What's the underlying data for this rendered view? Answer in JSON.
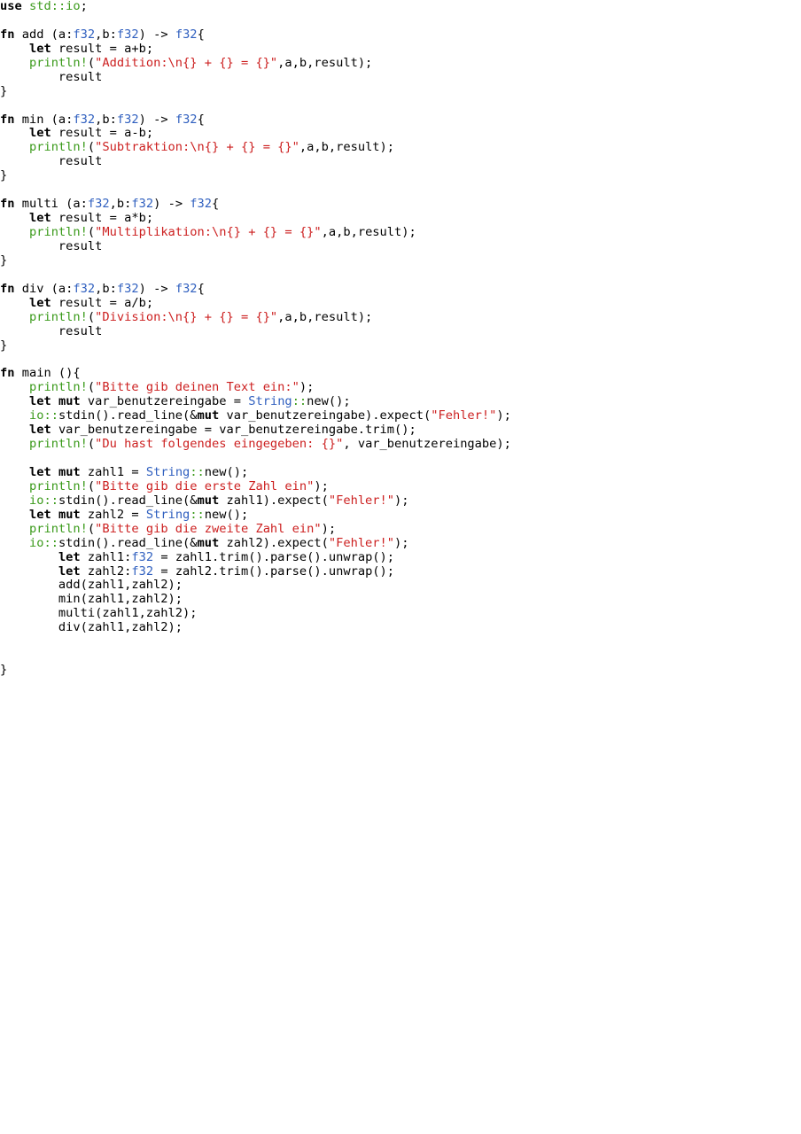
{
  "colors": {
    "keyword": "#000000",
    "type": "#2f5fbf",
    "macro": "#3a9a1a",
    "string": "#cc1f1f",
    "text": "#000000",
    "background": "#ffffff"
  },
  "code_lines": [
    [
      {
        "t": "kw",
        "v": "use"
      },
      {
        "t": "plain",
        "v": " "
      },
      {
        "t": "mac",
        "v": "std::io"
      },
      {
        "t": "plain",
        "v": ";"
      }
    ],
    [],
    [
      {
        "t": "kw",
        "v": "fn"
      },
      {
        "t": "plain",
        "v": " add (a:"
      },
      {
        "t": "ty",
        "v": "f32"
      },
      {
        "t": "plain",
        "v": ",b:"
      },
      {
        "t": "ty",
        "v": "f32"
      },
      {
        "t": "plain",
        "v": ") -> "
      },
      {
        "t": "ty",
        "v": "f32"
      },
      {
        "t": "plain",
        "v": "{"
      }
    ],
    [
      {
        "t": "plain",
        "v": "    "
      },
      {
        "t": "kw",
        "v": "let"
      },
      {
        "t": "plain",
        "v": " result = a+b;"
      }
    ],
    [
      {
        "t": "plain",
        "v": "    "
      },
      {
        "t": "mac",
        "v": "println!"
      },
      {
        "t": "plain",
        "v": "("
      },
      {
        "t": "str",
        "v": "\"Addition:\\n{} + {} = {}\""
      },
      {
        "t": "plain",
        "v": ",a,b,result);"
      }
    ],
    [
      {
        "t": "plain",
        "v": "        result"
      }
    ],
    [
      {
        "t": "plain",
        "v": "}"
      }
    ],
    [],
    [
      {
        "t": "kw",
        "v": "fn"
      },
      {
        "t": "plain",
        "v": " min (a:"
      },
      {
        "t": "ty",
        "v": "f32"
      },
      {
        "t": "plain",
        "v": ",b:"
      },
      {
        "t": "ty",
        "v": "f32"
      },
      {
        "t": "plain",
        "v": ") -> "
      },
      {
        "t": "ty",
        "v": "f32"
      },
      {
        "t": "plain",
        "v": "{"
      }
    ],
    [
      {
        "t": "plain",
        "v": "    "
      },
      {
        "t": "kw",
        "v": "let"
      },
      {
        "t": "plain",
        "v": " result = a-b;"
      }
    ],
    [
      {
        "t": "plain",
        "v": "    "
      },
      {
        "t": "mac",
        "v": "println!"
      },
      {
        "t": "plain",
        "v": "("
      },
      {
        "t": "str",
        "v": "\"Subtraktion:\\n{} + {} = {}\""
      },
      {
        "t": "plain",
        "v": ",a,b,result);"
      }
    ],
    [
      {
        "t": "plain",
        "v": "        result"
      }
    ],
    [
      {
        "t": "plain",
        "v": "}"
      }
    ],
    [],
    [
      {
        "t": "kw",
        "v": "fn"
      },
      {
        "t": "plain",
        "v": " multi (a:"
      },
      {
        "t": "ty",
        "v": "f32"
      },
      {
        "t": "plain",
        "v": ",b:"
      },
      {
        "t": "ty",
        "v": "f32"
      },
      {
        "t": "plain",
        "v": ") -> "
      },
      {
        "t": "ty",
        "v": "f32"
      },
      {
        "t": "plain",
        "v": "{"
      }
    ],
    [
      {
        "t": "plain",
        "v": "    "
      },
      {
        "t": "kw",
        "v": "let"
      },
      {
        "t": "plain",
        "v": " result = a*b;"
      }
    ],
    [
      {
        "t": "plain",
        "v": "    "
      },
      {
        "t": "mac",
        "v": "println!"
      },
      {
        "t": "plain",
        "v": "("
      },
      {
        "t": "str",
        "v": "\"Multiplikation:\\n{} + {} = {}\""
      },
      {
        "t": "plain",
        "v": ",a,b,result);"
      }
    ],
    [
      {
        "t": "plain",
        "v": "        result"
      }
    ],
    [
      {
        "t": "plain",
        "v": "}"
      }
    ],
    [],
    [
      {
        "t": "kw",
        "v": "fn"
      },
      {
        "t": "plain",
        "v": " div (a:"
      },
      {
        "t": "ty",
        "v": "f32"
      },
      {
        "t": "plain",
        "v": ",b:"
      },
      {
        "t": "ty",
        "v": "f32"
      },
      {
        "t": "plain",
        "v": ") -> "
      },
      {
        "t": "ty",
        "v": "f32"
      },
      {
        "t": "plain",
        "v": "{"
      }
    ],
    [
      {
        "t": "plain",
        "v": "    "
      },
      {
        "t": "kw",
        "v": "let"
      },
      {
        "t": "plain",
        "v": " result = a/b;"
      }
    ],
    [
      {
        "t": "plain",
        "v": "    "
      },
      {
        "t": "mac",
        "v": "println!"
      },
      {
        "t": "plain",
        "v": "("
      },
      {
        "t": "str",
        "v": "\"Division:\\n{} + {} = {}\""
      },
      {
        "t": "plain",
        "v": ",a,b,result);"
      }
    ],
    [
      {
        "t": "plain",
        "v": "        result"
      }
    ],
    [
      {
        "t": "plain",
        "v": "}"
      }
    ],
    [],
    [
      {
        "t": "kw",
        "v": "fn"
      },
      {
        "t": "plain",
        "v": " main (){"
      }
    ],
    [
      {
        "t": "plain",
        "v": "    "
      },
      {
        "t": "mac",
        "v": "println!"
      },
      {
        "t": "plain",
        "v": "("
      },
      {
        "t": "str",
        "v": "\"Bitte gib deinen Text ein:\""
      },
      {
        "t": "plain",
        "v": ");"
      }
    ],
    [
      {
        "t": "plain",
        "v": "    "
      },
      {
        "t": "kw",
        "v": "let"
      },
      {
        "t": "plain",
        "v": " "
      },
      {
        "t": "kw",
        "v": "mut"
      },
      {
        "t": "plain",
        "v": " var_benutzereingabe = "
      },
      {
        "t": "ty",
        "v": "String"
      },
      {
        "t": "mac",
        "v": "::"
      },
      {
        "t": "plain",
        "v": "new();"
      }
    ],
    [
      {
        "t": "plain",
        "v": "    "
      },
      {
        "t": "mac",
        "v": "io::"
      },
      {
        "t": "plain",
        "v": "stdin().read_line(&"
      },
      {
        "t": "kw",
        "v": "mut"
      },
      {
        "t": "plain",
        "v": " var_benutzereingabe).expect("
      },
      {
        "t": "str",
        "v": "\"Fehler!\""
      },
      {
        "t": "plain",
        "v": ");"
      }
    ],
    [
      {
        "t": "plain",
        "v": "    "
      },
      {
        "t": "kw",
        "v": "let"
      },
      {
        "t": "plain",
        "v": " var_benutzereingabe = var_benutzereingabe.trim();"
      }
    ],
    [
      {
        "t": "plain",
        "v": "    "
      },
      {
        "t": "mac",
        "v": "println!"
      },
      {
        "t": "plain",
        "v": "("
      },
      {
        "t": "str",
        "v": "\"Du hast folgendes eingegeben: {}\""
      },
      {
        "t": "plain",
        "v": ", var_benutzereingabe);"
      }
    ],
    [],
    [
      {
        "t": "plain",
        "v": "    "
      },
      {
        "t": "kw",
        "v": "let"
      },
      {
        "t": "plain",
        "v": " "
      },
      {
        "t": "kw",
        "v": "mut"
      },
      {
        "t": "plain",
        "v": " zahl1 = "
      },
      {
        "t": "ty",
        "v": "String"
      },
      {
        "t": "mac",
        "v": "::"
      },
      {
        "t": "plain",
        "v": "new();"
      }
    ],
    [
      {
        "t": "plain",
        "v": "    "
      },
      {
        "t": "mac",
        "v": "println!"
      },
      {
        "t": "plain",
        "v": "("
      },
      {
        "t": "str",
        "v": "\"Bitte gib die erste Zahl ein\""
      },
      {
        "t": "plain",
        "v": ");"
      }
    ],
    [
      {
        "t": "plain",
        "v": "    "
      },
      {
        "t": "mac",
        "v": "io::"
      },
      {
        "t": "plain",
        "v": "stdin().read_line(&"
      },
      {
        "t": "kw",
        "v": "mut"
      },
      {
        "t": "plain",
        "v": " zahl1).expect("
      },
      {
        "t": "str",
        "v": "\"Fehler!\""
      },
      {
        "t": "plain",
        "v": ");"
      }
    ],
    [
      {
        "t": "plain",
        "v": "    "
      },
      {
        "t": "kw",
        "v": "let"
      },
      {
        "t": "plain",
        "v": " "
      },
      {
        "t": "kw",
        "v": "mut"
      },
      {
        "t": "plain",
        "v": " zahl2 = "
      },
      {
        "t": "ty",
        "v": "String"
      },
      {
        "t": "mac",
        "v": "::"
      },
      {
        "t": "plain",
        "v": "new();"
      }
    ],
    [
      {
        "t": "plain",
        "v": "    "
      },
      {
        "t": "mac",
        "v": "println!"
      },
      {
        "t": "plain",
        "v": "("
      },
      {
        "t": "str",
        "v": "\"Bitte gib die zweite Zahl ein\""
      },
      {
        "t": "plain",
        "v": ");"
      }
    ],
    [
      {
        "t": "plain",
        "v": "    "
      },
      {
        "t": "mac",
        "v": "io::"
      },
      {
        "t": "plain",
        "v": "stdin().read_line(&"
      },
      {
        "t": "kw",
        "v": "mut"
      },
      {
        "t": "plain",
        "v": " zahl2).expect("
      },
      {
        "t": "str",
        "v": "\"Fehler!\""
      },
      {
        "t": "plain",
        "v": ");"
      }
    ],
    [
      {
        "t": "plain",
        "v": "        "
      },
      {
        "t": "kw",
        "v": "let"
      },
      {
        "t": "plain",
        "v": " zahl1:"
      },
      {
        "t": "ty",
        "v": "f32"
      },
      {
        "t": "plain",
        "v": " = zahl1.trim().parse().unwrap();"
      }
    ],
    [
      {
        "t": "plain",
        "v": "        "
      },
      {
        "t": "kw",
        "v": "let"
      },
      {
        "t": "plain",
        "v": " zahl2:"
      },
      {
        "t": "ty",
        "v": "f32"
      },
      {
        "t": "plain",
        "v": " = zahl2.trim().parse().unwrap();"
      }
    ],
    [
      {
        "t": "plain",
        "v": "        add(zahl1,zahl2);"
      }
    ],
    [
      {
        "t": "plain",
        "v": "        min(zahl1,zahl2);"
      }
    ],
    [
      {
        "t": "plain",
        "v": "        multi(zahl1,zahl2);"
      }
    ],
    [
      {
        "t": "plain",
        "v": "        div(zahl1,zahl2);"
      }
    ],
    [],
    [],
    [
      {
        "t": "plain",
        "v": "}"
      }
    ]
  ]
}
